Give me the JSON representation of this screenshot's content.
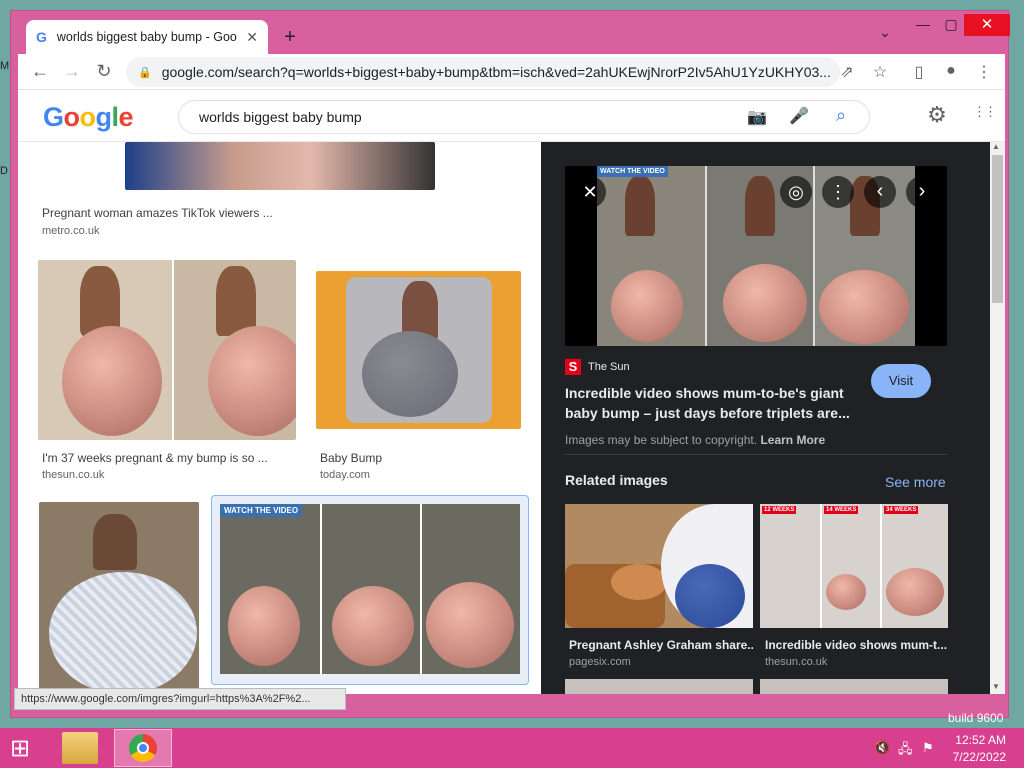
{
  "tab": {
    "title": "worlds biggest baby bump - Goo",
    "close": "✕",
    "new": "+"
  },
  "window_controls": {
    "menu": "⌄",
    "minimize": "—",
    "maximize": "▢",
    "close": "✕"
  },
  "toolbar": {
    "back": "←",
    "forward": "→",
    "reload": "↻",
    "url": "google.com/search?q=worlds+biggest+baby+bump&tbm=isch&ved=2ahUKEwjNrorP2Iv5AhU1YzUKHY03...",
    "share": "⇗",
    "star": "☆",
    "sidepanel": "▯",
    "profile": "●",
    "menu": "⋮"
  },
  "google": {
    "logo": [
      "G",
      "o",
      "o",
      "g",
      "l",
      "e"
    ],
    "logo_colors": [
      "#4285F4",
      "#EA4335",
      "#FBBC05",
      "#4285F4",
      "#34A853",
      "#EA4335"
    ],
    "query": "worlds biggest baby bump",
    "settings": "⚙",
    "apps": "⋮⋮"
  },
  "results": [
    {
      "title": "Pregnant woman amazes TikTok viewers ...",
      "source": "metro.co.uk"
    },
    {
      "title": "I'm 37 weeks pregnant & my bump is so ...",
      "source": "thesun.co.uk"
    },
    {
      "title": "Baby Bump",
      "source": "today.com"
    }
  ],
  "panel": {
    "source_icon": "S",
    "source": "The Sun",
    "title_line1": "Incredible video shows mum-to-be's giant",
    "title_line2": "baby bump – just days before triplets are...",
    "visit": "Visit",
    "copyright": "Images may be subject to copyright.",
    "learn_more": "Learn More",
    "related_title": "Related images",
    "see_more": "See more",
    "related": [
      {
        "title": "Pregnant Ashley Graham share...",
        "source": "pagesix.com"
      },
      {
        "title": "Incredible video shows mum-t...",
        "source": "thesun.co.uk"
      }
    ],
    "badges": [
      "WATCH THE VIDEO",
      "12 WEEKS",
      "14 WEEKS",
      "34 WEEKS"
    ],
    "close": "✕",
    "lens": "◎",
    "more": "⋮",
    "prev": "‹",
    "next": "›"
  },
  "status_url": "https://www.google.com/imgres?imgurl=https%3A%2F%2...",
  "taskbar": {
    "start": "⊞",
    "time": "12:52 AM",
    "date": "7/22/2022",
    "watermark": "build 9600"
  }
}
